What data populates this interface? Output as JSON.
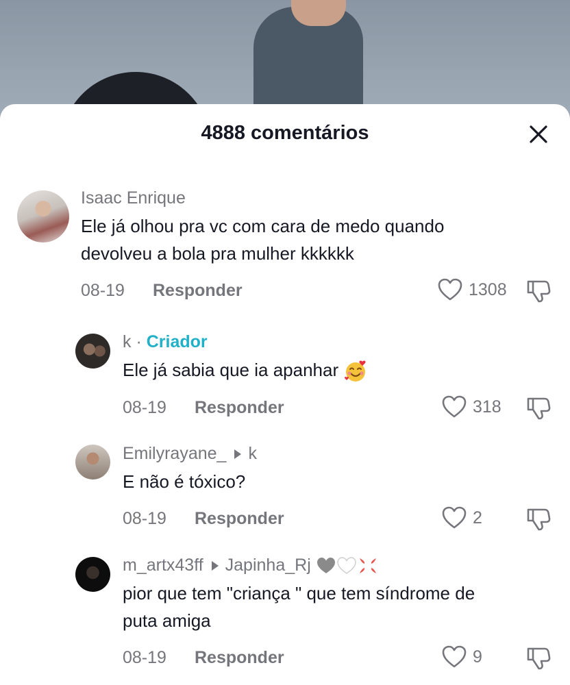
{
  "header": {
    "title": "4888 comentários"
  },
  "comments": [
    {
      "username": "Isaac Enrique",
      "text_line1": "Ele já olhou pra vc com cara de medo quando",
      "text_line2": "devolveu a bola pra mulher kkkkkk",
      "date": "08-19",
      "reply_label": "Responder",
      "likes": "1308"
    },
    {
      "username": "k",
      "separator": "·",
      "badge": "Criador",
      "text": "Ele já sabia que ia apanhar",
      "emoji": "smiling-face-with-hearts",
      "date": "08-19",
      "reply_label": "Responder",
      "likes": "318"
    },
    {
      "username": "Emilyrayane_",
      "reply_to": "k",
      "text": "E não é tóxico?",
      "date": "08-19",
      "reply_label": "Responder",
      "likes": "2"
    },
    {
      "username": "m_artx43ff",
      "reply_to": "Japinha_Rj",
      "reply_to_emojis": [
        "grey-heart",
        "white-heart",
        "anger-symbol"
      ],
      "text_line1": "pior que tem \"criança \" que tem síndrome de",
      "text_line2": "puta amiga",
      "date": "08-19",
      "reply_label": "Responder",
      "likes": "9"
    }
  ],
  "colors": {
    "primary_text": "#161823",
    "secondary_text": "#75767c",
    "creator_badge": "#20b1c9",
    "sheet_bg": "#ffffff"
  }
}
